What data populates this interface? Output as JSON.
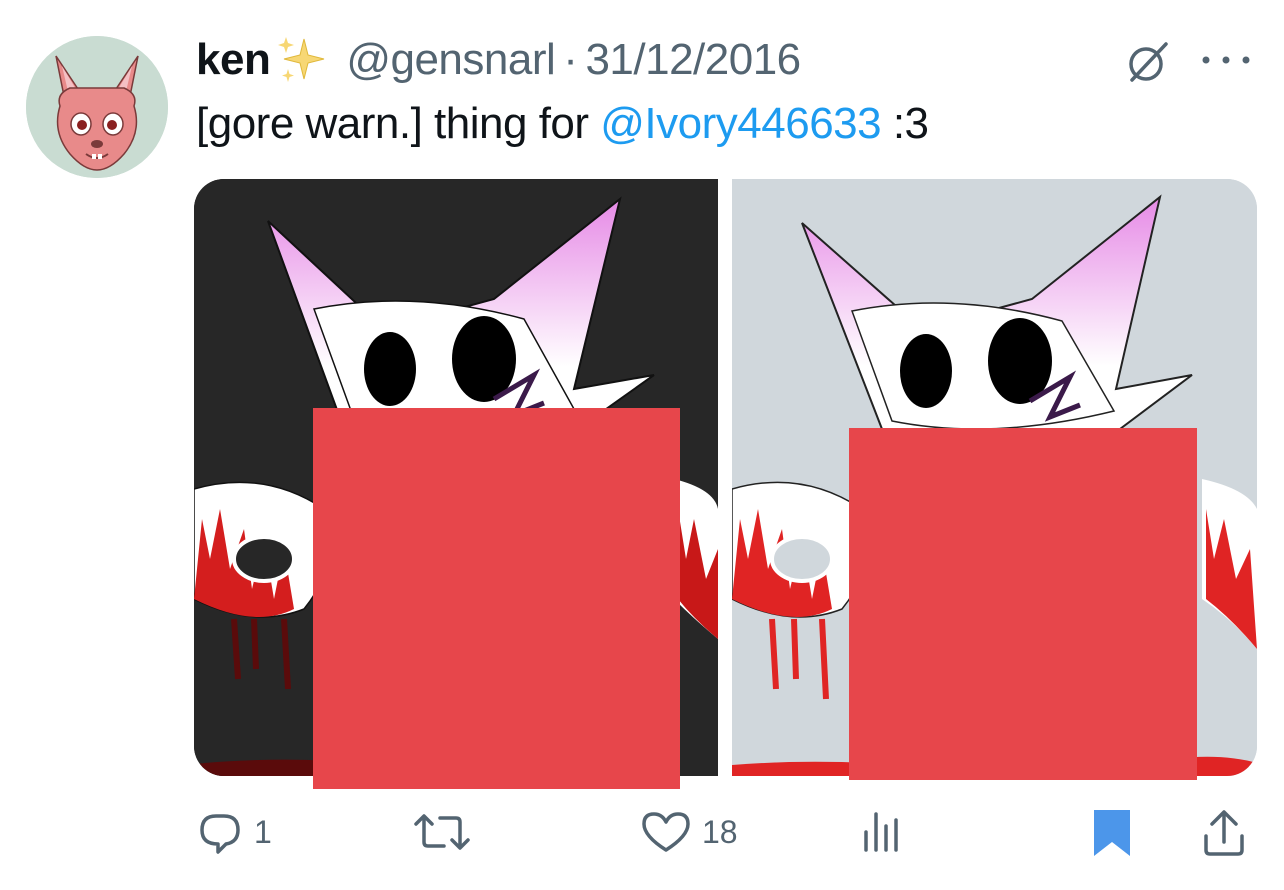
{
  "tweet": {
    "author_name": "ken",
    "author_handle": "@gensnarl",
    "separator": "·",
    "date": "31/12/2016",
    "text_prefix": "[gore warn.] thing for ",
    "mention": "@Ivory446633",
    "text_suffix": " :3"
  },
  "actions": {
    "reply_count": "1",
    "retweet_count": "",
    "like_count": "18",
    "bookmarked": true
  },
  "icons": {
    "avatar": "fox-avatar",
    "sparkle": "sparkles-emoji",
    "grok": "grok-icon",
    "more": "more-icon",
    "reply": "reply-icon",
    "retweet": "retweet-icon",
    "like": "heart-icon",
    "views": "analytics-icon",
    "bookmark": "bookmark-icon",
    "share": "share-icon"
  },
  "colors": {
    "accent": "#1d9bf0",
    "muted": "#536471",
    "censor": "#e7464b",
    "bookmark": "#4c96ea",
    "avatar_bg": "#c9dcd2"
  }
}
